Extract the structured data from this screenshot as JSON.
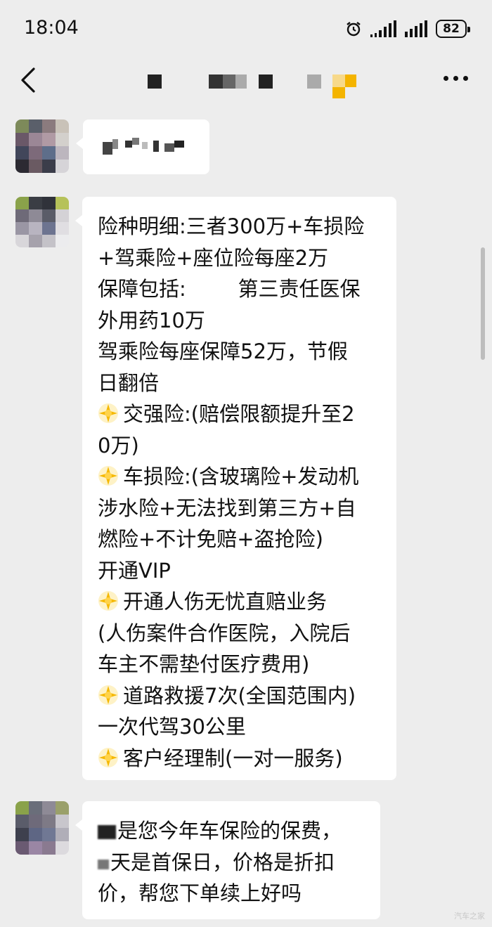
{
  "status_bar": {
    "time": "18:04",
    "battery": "82",
    "icons": [
      "alarm-icon",
      "signal-icon",
      "signal-icon",
      "battery-icon"
    ]
  },
  "nav": {
    "back_icon": "chevron-left-icon",
    "more_icon": "more-dots-icon"
  },
  "messages": {
    "main_lines": [
      "险种明细:三者300万+车损险",
      "+驾乘险+座位险每座2万",
      "保障包括:        第三责任医保",
      "外用药10万",
      "驾乘险每座保障52万，节假",
      "日翻倍",
      "交强险:(赔偿限额提升至2",
      "0万)",
      "车损险:(含玻璃险+发动机",
      "涉水险+无法找到第三方+自",
      "燃险+不计免赔+盗抢险)",
      "开通VIP",
      "开通人伤无忧直赔业务",
      "(人伤案件合作医院，入院后",
      "车主不需垫付医疗费用)",
      "道路救援7次(全国范围内)",
      "一次代驾30公里",
      "客户经理制(一对一服务)"
    ],
    "last_lines": [
      "是您今年车保险的保费，",
      "天是首保日，价格是折扣",
      "价，帮您下单续上好吗"
    ]
  },
  "watermark": "汽车之家",
  "colors": {
    "background": "#ededed",
    "bubble": "#ffffff",
    "text": "#111111"
  }
}
